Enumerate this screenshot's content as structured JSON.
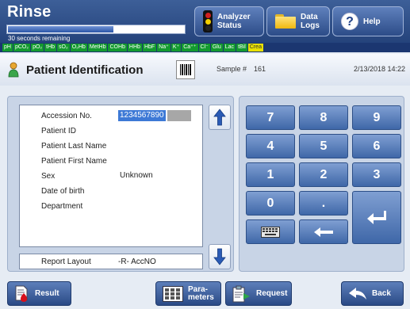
{
  "header": {
    "mode": "Rinse",
    "progress_fraction": 0.6,
    "progress_text": "30 seconds remaining",
    "params": [
      "pH",
      "pCO₂",
      "pO₂",
      "tHb",
      "sO₂",
      "O₂Hb",
      "MetHb",
      "COHb",
      "HHb",
      "HbF",
      "Na⁺",
      "K⁺",
      "Ca⁺⁺",
      "Cl⁻",
      "Glu",
      "Lac",
      "tBil",
      "Crea"
    ],
    "highlighted_param": "Crea",
    "buttons": {
      "analyzer_status_line1": "Analyzer",
      "analyzer_status_line2": "Status",
      "data_logs_line1": "Data",
      "data_logs_line2": "Logs",
      "help": "Help"
    }
  },
  "title_row": {
    "title": "Patient Identification",
    "sample_label": "Sample #",
    "sample_value": "161",
    "datetime": "2/13/2018 14:22"
  },
  "fields": [
    {
      "label": "Accession No.",
      "value": "1234567890",
      "selected": true
    },
    {
      "label": "Patient ID",
      "value": ""
    },
    {
      "label": "Patient Last Name",
      "value": ""
    },
    {
      "label": "Patient First Name",
      "value": ""
    },
    {
      "label": "Sex",
      "value": "Unknown"
    },
    {
      "label": "Date of birth",
      "value": ""
    },
    {
      "label": "Department",
      "value": ""
    }
  ],
  "report_layout": {
    "label": "Report Layout",
    "value": "-R- AccNO"
  },
  "keypad": {
    "k7": "7",
    "k8": "8",
    "k9": "9",
    "k4": "4",
    "k5": "5",
    "k6": "6",
    "k1": "1",
    "k2": "2",
    "k3": "3",
    "k0": "0",
    "dot": "."
  },
  "bottom": {
    "result": "Result",
    "params_line1": "Para-",
    "params_line2": "meters",
    "request": "Request",
    "back": "Back"
  },
  "colors": {
    "header_bg": "#2c4c88",
    "param_chip": "#139a2f",
    "param_highlight": "#e8e000",
    "key_bg": "#4f74b4",
    "selection": "#3d79d6"
  }
}
